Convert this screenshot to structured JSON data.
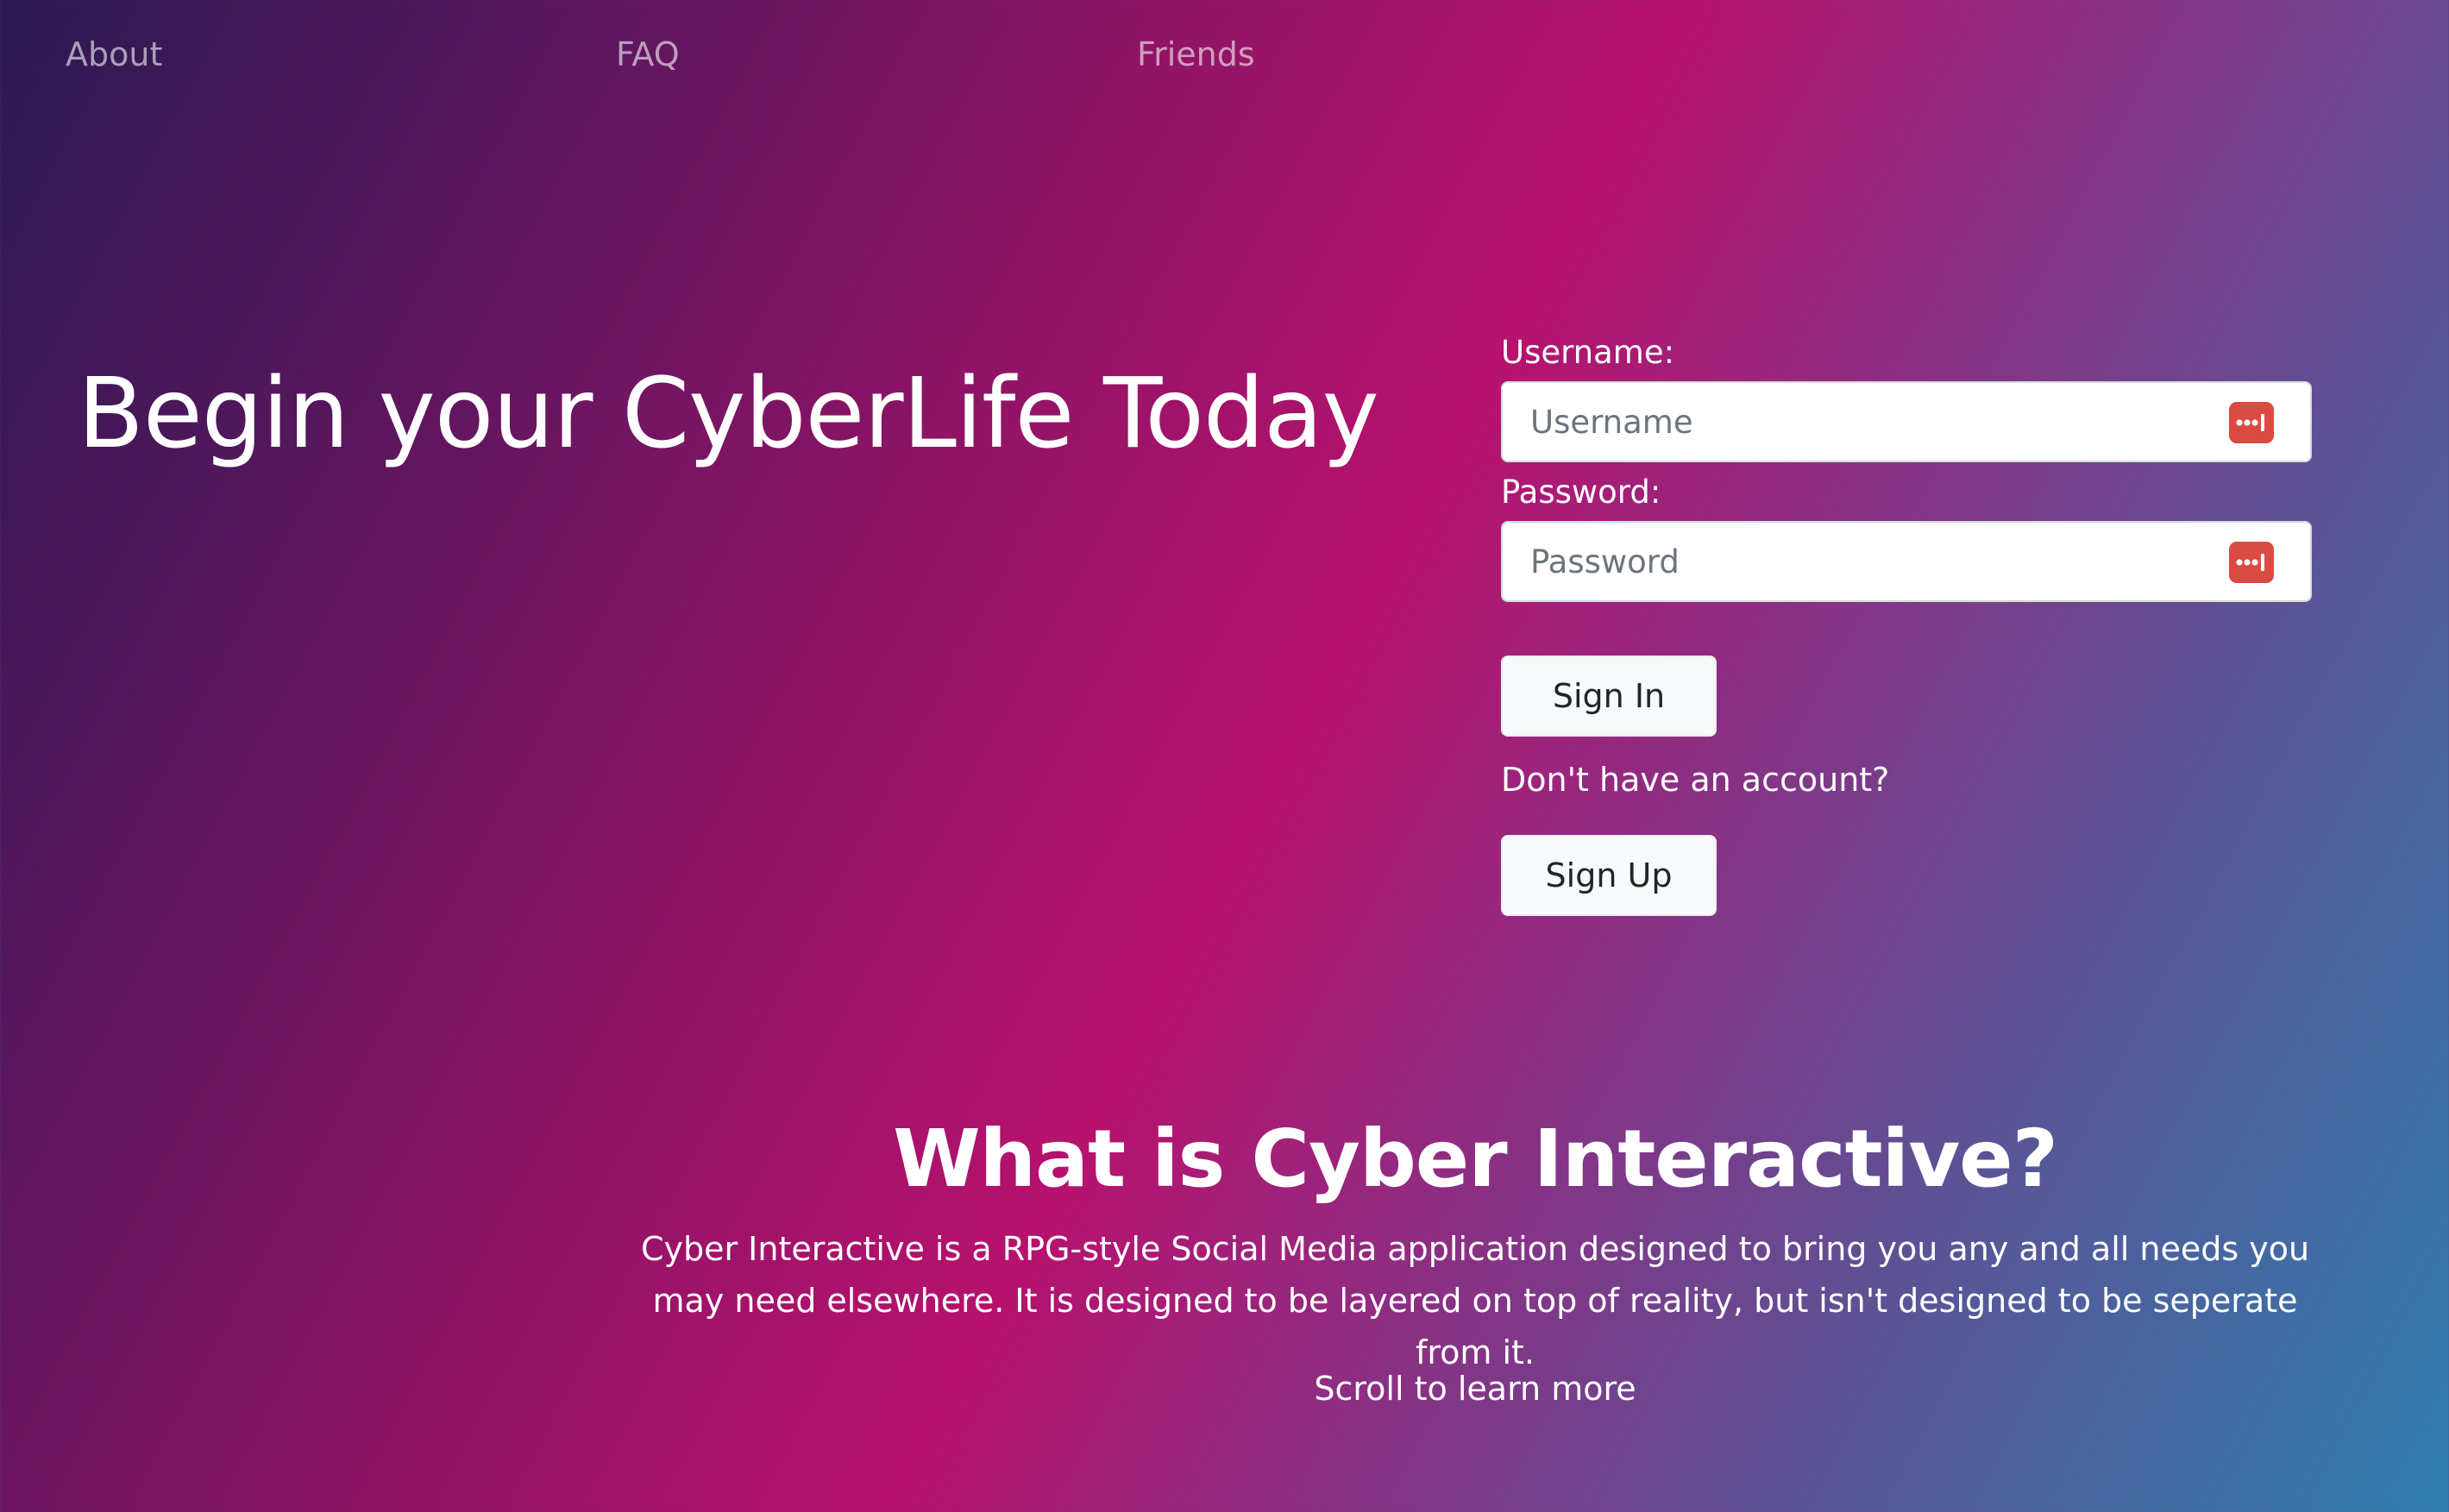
{
  "nav": {
    "items": [
      {
        "label": "About"
      },
      {
        "label": "FAQ"
      },
      {
        "label": "Friends"
      }
    ]
  },
  "hero": {
    "title": "Begin your CyberLife Today"
  },
  "login": {
    "username_label": "Username:",
    "username_placeholder": "Username",
    "username_value": "",
    "password_label": "Password:",
    "password_placeholder": "Password",
    "password_value": "",
    "password_manager_icon": "password-manager-icon",
    "password_manager_color": "#d94a43",
    "signin_label": "Sign In",
    "no_account_text": "Don't have an account?",
    "signup_label": "Sign Up"
  },
  "info": {
    "title": "What is Cyber Interactive?",
    "description": "Cyber Interactive is a RPG-style Social Media application designed to bring you any and all needs you may need elsewhere. It is designed to be layered on top of reality, but isn't designed to be seperate from it.",
    "scroll_hint": "Scroll to learn more"
  },
  "colors": {
    "gradient": [
      "#2a1a52",
      "#b7126e",
      "#2f7eaf"
    ],
    "text": "#ffffff",
    "nav_text": "rgba(255,255,255,0.58)",
    "button_bg": "#f8f9fa"
  }
}
